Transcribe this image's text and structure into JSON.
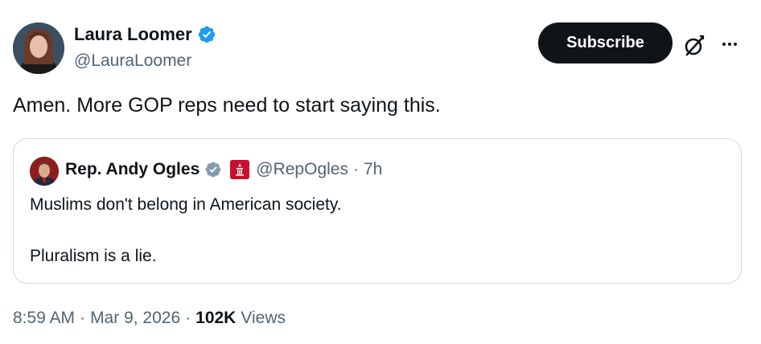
{
  "post": {
    "author_name": "Laura Loomer",
    "author_handle": "@LauraLoomer",
    "subscribe_label": "Subscribe",
    "text": "Amen. More GOP reps need to start saying this."
  },
  "quote": {
    "author_name": "Rep. Andy Ogles",
    "author_handle": "@RepOgles",
    "separator": "·",
    "time": "7h",
    "line1": "Muslims don't belong in American society.",
    "line2": "Pluralism is a lie."
  },
  "meta": {
    "time": "8:59 AM",
    "sep1": "·",
    "date": "Mar 9, 2026",
    "sep2": "·",
    "views_count": "102K",
    "views_label": "Views"
  },
  "icons": {
    "verified": "verified-badge-icon",
    "gov_badge": "government-badge-icon",
    "grok": "grok-icon",
    "more": "more-options-icon"
  },
  "colors": {
    "text": "#0f1419",
    "secondary": "#536471",
    "verified_blue": "#1d9bf0",
    "gov_gray": "#829aab",
    "border": "#cfd9de",
    "button_bg": "#0f1419"
  }
}
